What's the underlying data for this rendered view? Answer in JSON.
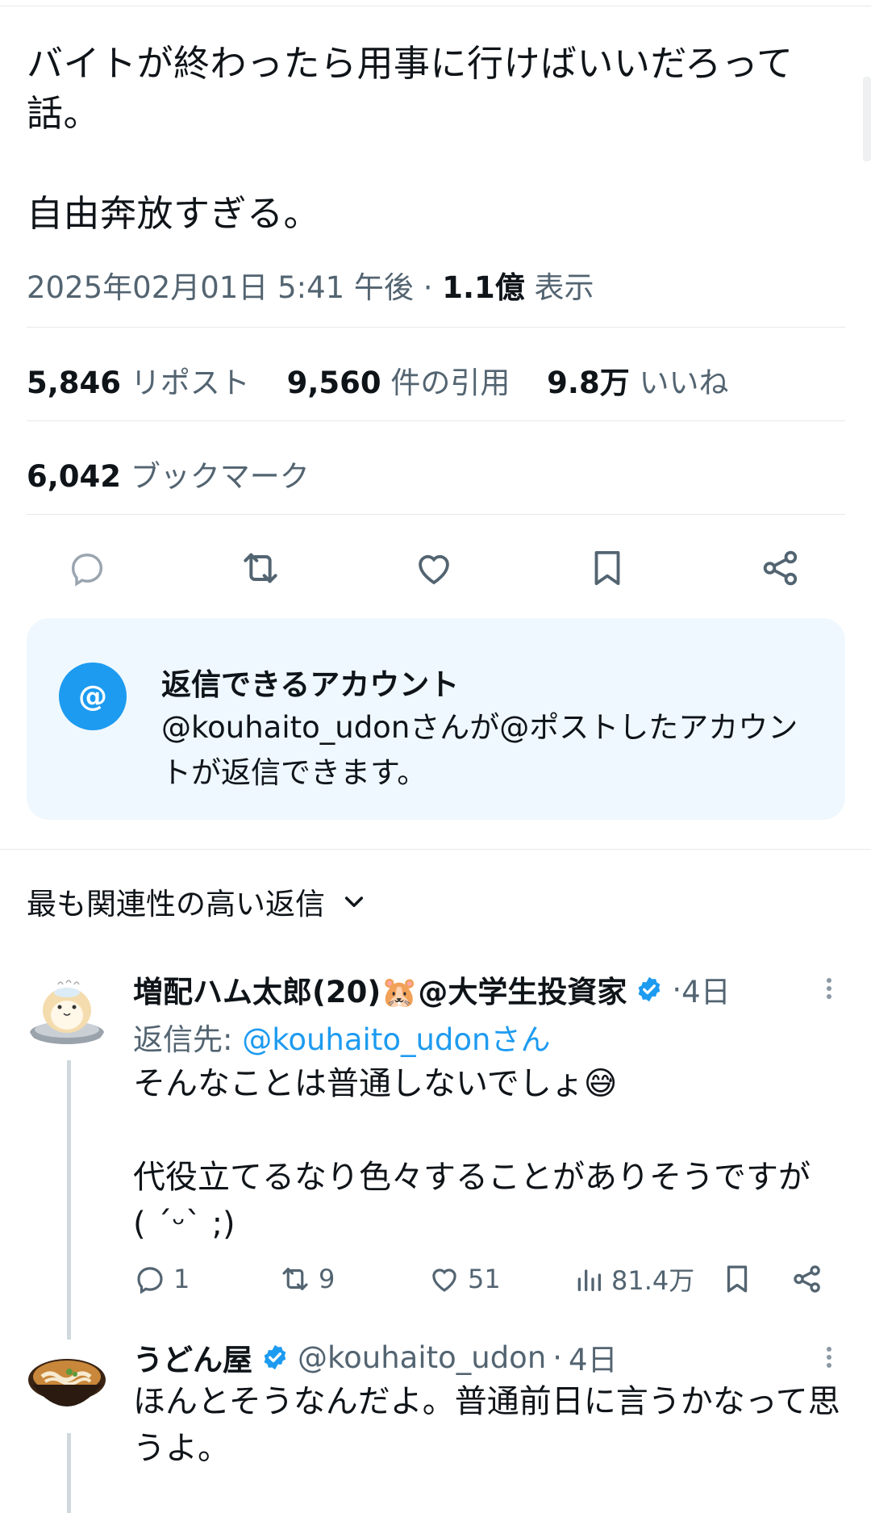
{
  "post": {
    "text": "バイトが終わったら用事に行けばいいだろって話。\n\n自由奔放すぎる。",
    "timestamp": "2025年02月01日 5:41 午後",
    "views_value": "1.1億",
    "views_label": "表示",
    "reposts_value": "5,846",
    "reposts_label": "リポスト",
    "quotes_value": "9,560",
    "quotes_label": "件の引用",
    "likes_value": "9.8万",
    "likes_label": "いいね",
    "bookmarks_value": "6,042",
    "bookmarks_label": "ブックマーク"
  },
  "reply_notice": {
    "icon_text": "@",
    "title": "返信できるアカウント",
    "body": "@kouhaito_udonさんが@ポストしたアカウントが返信できます。"
  },
  "sort": {
    "label": "最も関連性の高い返信"
  },
  "replies": [
    {
      "name": "増配ハム太郎(20)🐹@大学生投資家",
      "time": "4日",
      "reply_to_prefix": "返信先:",
      "reply_to_handle": "@kouhaito_udonさん",
      "text": "そんなことは普通しないでしょ😅\n\n代役立てるなり色々することがありそうですが\n( ´ᵕ` ;)",
      "reply_count": "1",
      "repost_count": "9",
      "like_count": "51",
      "view_count": "81.4万"
    },
    {
      "name": "うどん屋",
      "handle": "@kouhaito_udon",
      "time": "4日",
      "text": "ほんとそうなんだよ。普通前日に言うかなって思うよ。"
    }
  ],
  "colors": {
    "accent": "#1d9bf0",
    "secondary_text": "#536471",
    "notice_bg": "#eff8fe"
  }
}
